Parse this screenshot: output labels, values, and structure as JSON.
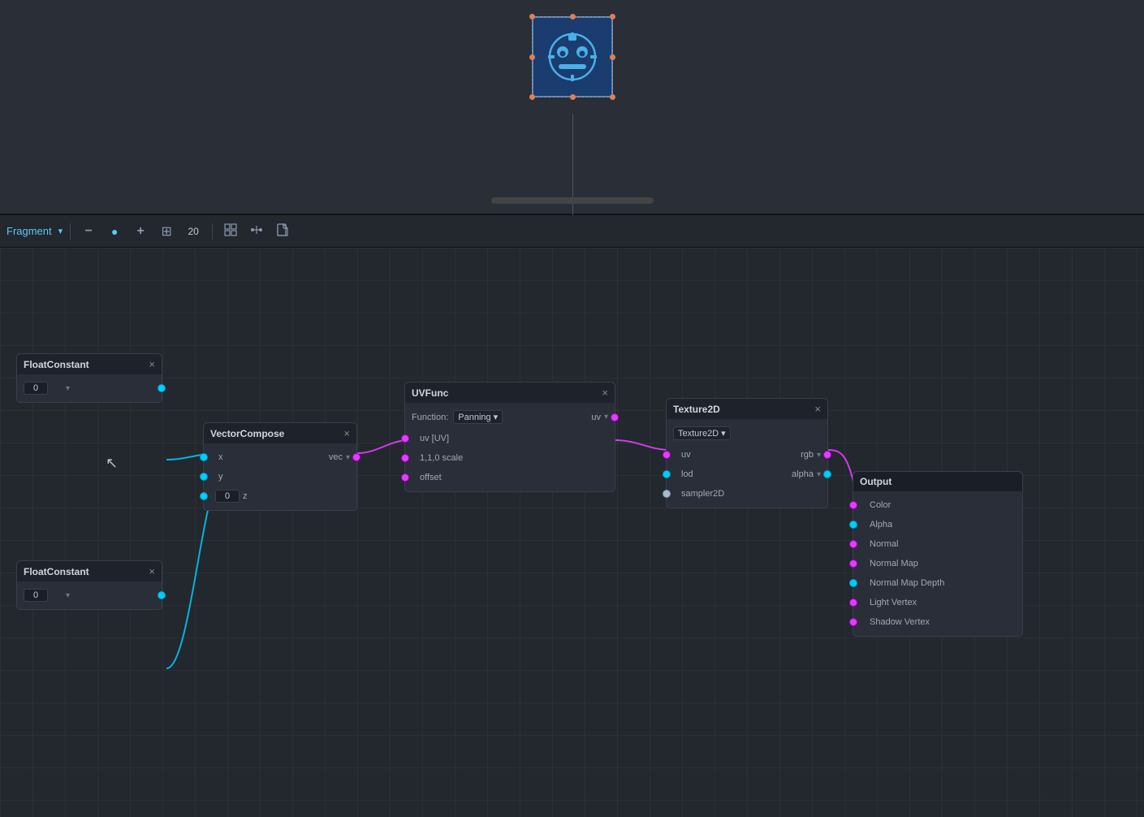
{
  "topPreview": {
    "bg": "#2a2e36"
  },
  "toolbar": {
    "shaderType": "Fragment",
    "zoom": "20",
    "buttons": [
      "minus",
      "info",
      "plus",
      "layout",
      "grid",
      "connection",
      "file"
    ],
    "dropdownArrow": "▾"
  },
  "nodes": {
    "floatConstant1": {
      "title": "FloatConstant",
      "value": "0"
    },
    "floatConstant2": {
      "title": "FloatConstant",
      "value": "0"
    },
    "vectorCompose": {
      "title": "VectorCompose",
      "ports": [
        "x",
        "y",
        "z"
      ],
      "outputLabel": "vec",
      "zValue": "0"
    },
    "uvfunc": {
      "title": "UVFunc",
      "functionLabel": "Function:",
      "functionValue": "Panning",
      "ports": [
        "uv  [UV]",
        "1,1,0  scale",
        "offset"
      ],
      "outputLabel": "uv"
    },
    "texture2d": {
      "title": "Texture2D",
      "textureLabel": "Texture2D",
      "ports": [
        "uv",
        "lod",
        "sampler2D"
      ],
      "outputPorts": [
        "rgb",
        "alpha"
      ]
    },
    "output": {
      "title": "Output",
      "ports": [
        "Color",
        "Alpha",
        "Normal",
        "Normal Map",
        "Normal Map Depth",
        "Light Vertex",
        "Shadow Vertex"
      ]
    }
  },
  "icons": {
    "minus": "−",
    "info": "ℹ",
    "plus": "+",
    "layout": "⊞",
    "grid": "⊟",
    "connection": "⇄",
    "file": "📄",
    "close": "×",
    "chevronDown": "▾",
    "chevronUpDown": "⇅"
  }
}
